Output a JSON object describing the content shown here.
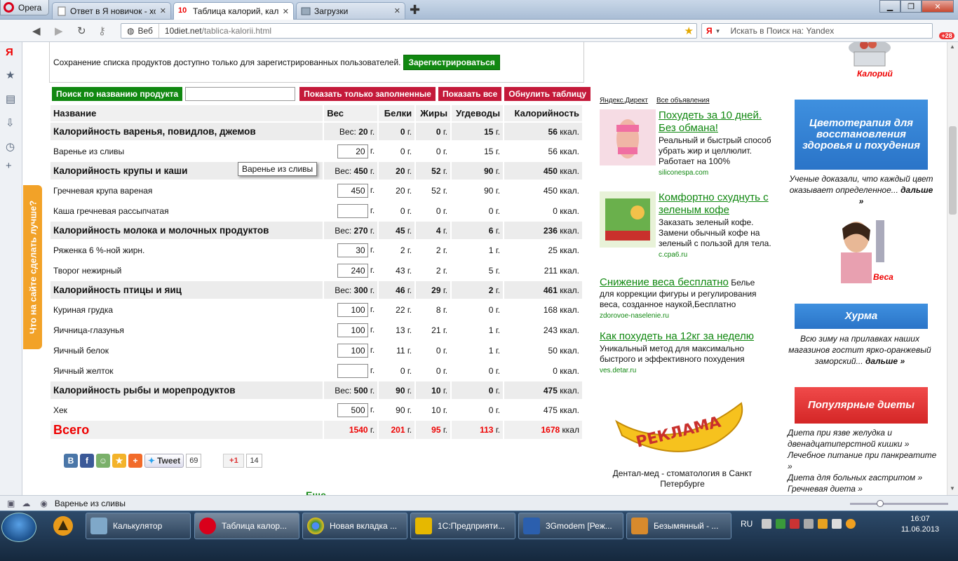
{
  "browser": {
    "menu_label": "Opera",
    "tabs": [
      {
        "title": "Ответ в Я новичок - хо...",
        "active": false
      },
      {
        "title": "Таблица калорий, кал...",
        "active": true
      },
      {
        "title": "Загрузки",
        "active": false
      }
    ],
    "favicon_label": "10",
    "address_prefix": "Веб",
    "url_host": "10diet.net",
    "url_path": "/tablica-kalorii.html",
    "search_brand": "Я",
    "search_placeholder": "Искать в Поиск на: Yandex",
    "extension_badge": "+28"
  },
  "feedback_tab": "Что на сайте сделать лучше?",
  "notice": {
    "text": "Сохранение списка продуктов доступно только для зарегистрированных пользователей.",
    "register_button": "Зарегистрироваться"
  },
  "toolbar": {
    "search_button": "Поиск по названию продукта",
    "search_value": "",
    "show_filled": "Показать только заполненные",
    "show_all": "Показать все",
    "reset": "Обнулить таблицу"
  },
  "table": {
    "headers": {
      "name": "Название",
      "weight": "Вес",
      "protein": "Белки",
      "fat": "Жиры",
      "carbs": "Угдеводы",
      "calories": "Калорийность"
    },
    "weight_prefix": "Вес:",
    "unit_g": "г.",
    "unit_kcal": "ккал.",
    "groups": [
      {
        "name": "Калорийность варенья, повидлов, джемов",
        "weight": "20",
        "protein": "0",
        "fat": "0",
        "carbs": "15",
        "kcal": "56",
        "items": [
          {
            "name": "Варенье из сливы",
            "weight": "20",
            "protein": "0",
            "fat": "0",
            "carbs": "15",
            "kcal": "56"
          }
        ]
      },
      {
        "name": "Калорийность крупы и каши",
        "weight": "450",
        "protein": "20",
        "fat": "52",
        "carbs": "90",
        "kcal": "450",
        "items": [
          {
            "name": "Гречневая крупа вареная",
            "weight": "450",
            "protein": "20",
            "fat": "52",
            "carbs": "90",
            "kcal": "450"
          },
          {
            "name": "Каша гречневая рассыпчатая",
            "weight": "",
            "protein": "0",
            "fat": "0",
            "carbs": "0",
            "kcal": "0"
          }
        ]
      },
      {
        "name": "Калорийность молока и молочных продуктов",
        "weight": "270",
        "protein": "45",
        "fat": "4",
        "carbs": "6",
        "kcal": "236",
        "items": [
          {
            "name": "Ряженка 6 %-ной жирн.",
            "weight": "30",
            "protein": "2",
            "fat": "2",
            "carbs": "1",
            "kcal": "25"
          },
          {
            "name": "Творог нежирный",
            "weight": "240",
            "protein": "43",
            "fat": "2",
            "carbs": "5",
            "kcal": "211"
          }
        ]
      },
      {
        "name": "Калорийность птицы и яиц",
        "weight": "300",
        "protein": "46",
        "fat": "29",
        "carbs": "2",
        "kcal": "461",
        "items": [
          {
            "name": "Куриная грудка",
            "weight": "100",
            "protein": "22",
            "fat": "8",
            "carbs": "0",
            "kcal": "168"
          },
          {
            "name": "Яичница-глазунья",
            "weight": "100",
            "protein": "13",
            "fat": "21",
            "carbs": "1",
            "kcal": "243"
          },
          {
            "name": "Яичный белок",
            "weight": "100",
            "protein": "11",
            "fat": "0",
            "carbs": "1",
            "kcal": "50"
          },
          {
            "name": "Яичный желток",
            "weight": "",
            "protein": "0",
            "fat": "0",
            "carbs": "0",
            "kcal": "0"
          }
        ]
      },
      {
        "name": "Калорийность рыбы и морепродуктов",
        "weight": "500",
        "protein": "90",
        "fat": "10",
        "carbs": "0",
        "kcal": "475",
        "items": [
          {
            "name": "Хек",
            "weight": "500",
            "protein": "90",
            "fat": "10",
            "carbs": "0",
            "kcal": "475"
          }
        ]
      }
    ],
    "total": {
      "label": "Всего",
      "weight": "1540",
      "protein": "201",
      "fat": "95",
      "carbs": "113",
      "kcal": "1678",
      "kcal_unit": "ккал"
    }
  },
  "tooltip": "Варенье из сливы",
  "social": {
    "tweet": "Tweet",
    "tweet_count": "69",
    "gplus": "+1",
    "gplus_count": "14"
  },
  "more_link": "Еще",
  "ads": {
    "header_left": "Яндекс.Директ",
    "header_right": "Все объявления",
    "items": [
      {
        "title": "Похудеть за 10 дней. Без обмана!",
        "desc": "Реальный и быстрый способ убрать жир и целлюлит. Работает на 100%",
        "domain": "siliconespa.com"
      },
      {
        "title": "Комфортно схуднуть с зеленым кофе",
        "desc": "Заказать зеленый кофе. Замени обычный кофе на зеленый с пользой для тела.",
        "domain": "c.cpa6.ru"
      },
      {
        "title": "Снижение веса бесплатно",
        "desc": "Белье для коррекции фигуры и регулирования веса, созданное наукой,Бесплатно",
        "domain": "zdorovoe-naselenie.ru"
      },
      {
        "title": "Как похудеть на 12кг за неделю",
        "desc": "Уникальный метод для максимально быстрого и эффективного похудения",
        "domain": "ves.detar.ru"
      }
    ],
    "banana_text": "РЕКЛАМА",
    "banner_caption": "Дентал-мед - стоматология в Санкт Петербурге"
  },
  "right_col": {
    "kal_label": "Калорий",
    "box1": "Цветотерапия для восстановления здоровья и похудения",
    "text1": "Ученые доказали, что каждый цвет оказывает определенное...",
    "more": "дальше »",
    "ves_label": "Веса",
    "box2": "Хурма",
    "text2": "Всю зиму на прилавках наших магазинов гостит ярко-оранжевый заморский...",
    "box3": "Популярные диеты",
    "diets": [
      "Диета при язве желудка и двенадцатиперстной кишки »",
      "Лечебное питание при панкреатите »",
      "Диета для больных гастритом »",
      "Гречневая диета »"
    ]
  },
  "statusbar": {
    "text": "Варенье из сливы"
  },
  "taskbar": {
    "items": [
      {
        "label": "Калькулятор",
        "color": "#7fa8c9"
      },
      {
        "label": "Таблица калор...",
        "color": "#d9001b"
      },
      {
        "label": "Новая вкладка ...",
        "color": "#3d8c3d"
      },
      {
        "label": "1С:Предприяти...",
        "color": "#e6b800"
      },
      {
        "label": "3Gmodem [Реж...",
        "color": "#2b5fae"
      },
      {
        "label": "Безымянный - ...",
        "color": "#d88a2c"
      }
    ],
    "lang": "RU",
    "time": "16:07",
    "date": "11.06.2013"
  }
}
